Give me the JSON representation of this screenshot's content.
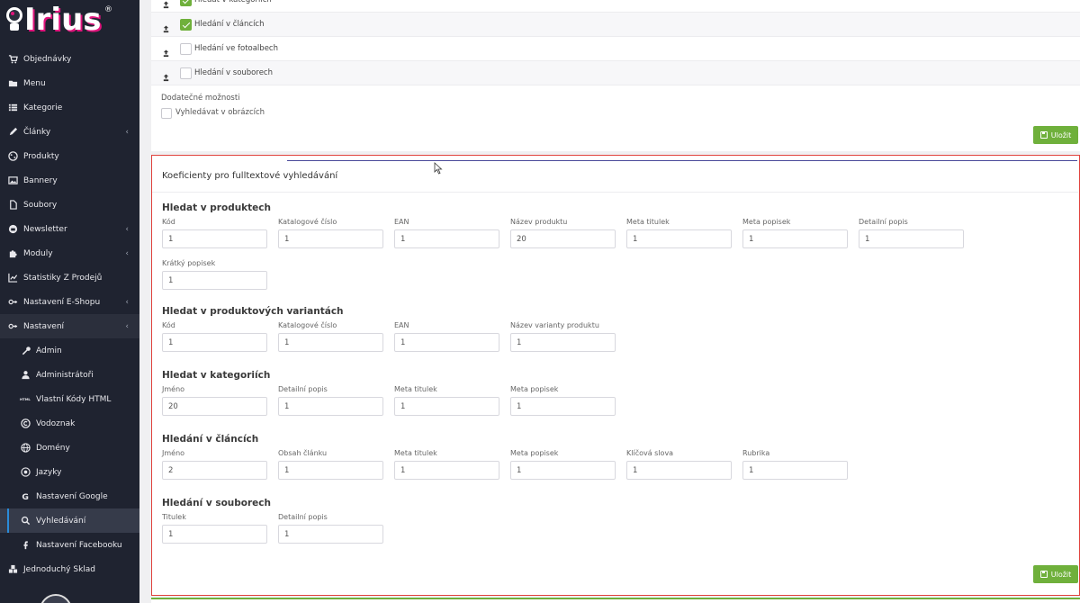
{
  "brand": {
    "logo_text": "Irius",
    "reg_mark": "®"
  },
  "sidebar": {
    "items": [
      {
        "label": "Objednávky",
        "icon": "cart-icon",
        "chevron": false
      },
      {
        "label": "Menu",
        "icon": "folder-icon",
        "chevron": false
      },
      {
        "label": "Kategorie",
        "icon": "list-icon",
        "chevron": false
      },
      {
        "label": "Články",
        "icon": "pen-icon",
        "chevron": true
      },
      {
        "label": "Produkty",
        "icon": "dice-icon",
        "chevron": false
      },
      {
        "label": "Bannery",
        "icon": "image-icon",
        "chevron": false
      },
      {
        "label": "Soubory",
        "icon": "file-icon",
        "chevron": false
      },
      {
        "label": "Newsletter",
        "icon": "envelope-icon",
        "chevron": true
      },
      {
        "label": "Moduly",
        "icon": "puzzle-icon",
        "chevron": true
      },
      {
        "label": "Statistiky Z Prodejů",
        "icon": "chart-icon",
        "chevron": false
      },
      {
        "label": "Nastavení E-Shopu",
        "icon": "toggle-icon",
        "chevron": true
      },
      {
        "label": "Nastavení",
        "icon": "toggle-icon",
        "chevron": true
      }
    ],
    "sub_items": [
      {
        "label": "Admin",
        "icon": "wrench-icon"
      },
      {
        "label": "Administrátoři",
        "icon": "user-icon"
      },
      {
        "label": "Vlastní Kódy HTML",
        "icon": "html-icon"
      },
      {
        "label": "Vodoznak",
        "icon": "copyright-icon"
      },
      {
        "label": "Domény",
        "icon": "globe-icon"
      },
      {
        "label": "Jazyky",
        "icon": "language-icon"
      },
      {
        "label": "Nastavení Google",
        "icon": "google-icon"
      },
      {
        "label": "Vyhledávání",
        "icon": "search-icon",
        "active": true
      },
      {
        "label": "Nastavení Facebooku",
        "icon": "facebook-icon"
      }
    ],
    "bottom_item": {
      "label": "Jednoduchý Sklad",
      "icon": "boxes-icon"
    }
  },
  "top_card": {
    "rows": [
      {
        "label": "Hledat v kategoriích",
        "checked": true
      },
      {
        "label": "Hledání v článcích",
        "checked": true
      },
      {
        "label": "Hledání ve fotoalbech",
        "checked": false
      },
      {
        "label": "Hledání v souborech",
        "checked": false
      }
    ],
    "extra_title": "Dodatečné možnosti",
    "extra_option": {
      "label": "Vyhledávat v obrázcích",
      "checked": false
    },
    "save_label": "Uložit"
  },
  "coef_card": {
    "title": "Koeficienty pro fulltextové vyhledávání",
    "save_label": "Uložit",
    "groups": [
      {
        "title": "Hledat v produktech",
        "fields": [
          {
            "label": "Kód",
            "value": "1"
          },
          {
            "label": "Katalogové číslo",
            "value": "1"
          },
          {
            "label": "EAN",
            "value": "1"
          },
          {
            "label": "Název produktu",
            "value": "20"
          },
          {
            "label": "Meta titulek",
            "value": "1"
          },
          {
            "label": "Meta popisek",
            "value": "1"
          },
          {
            "label": "Detailní popis",
            "value": "1"
          },
          {
            "label": "Krátký popisek",
            "value": "1"
          }
        ]
      },
      {
        "title": "Hledat v produktových variantách",
        "fields": [
          {
            "label": "Kód",
            "value": "1"
          },
          {
            "label": "Katalogové číslo",
            "value": "1"
          },
          {
            "label": "EAN",
            "value": "1"
          },
          {
            "label": "Název varianty produktu",
            "value": "1"
          }
        ]
      },
      {
        "title": "Hledat v kategoriích",
        "fields": [
          {
            "label": "Jméno",
            "value": "20"
          },
          {
            "label": "Detailní popis",
            "value": "1"
          },
          {
            "label": "Meta titulek",
            "value": "1"
          },
          {
            "label": "Meta popisek",
            "value": "1"
          }
        ]
      },
      {
        "title": "Hledání v článcích",
        "fields": [
          {
            "label": "Jméno",
            "value": "2"
          },
          {
            "label": "Obsah článku",
            "value": "1"
          },
          {
            "label": "Meta titulek",
            "value": "1"
          },
          {
            "label": "Meta popisek",
            "value": "1"
          },
          {
            "label": "Klíčová slova",
            "value": "1"
          },
          {
            "label": "Rubrika",
            "value": "1"
          }
        ]
      },
      {
        "title": "Hledání v souborech",
        "fields": [
          {
            "label": "Titulek",
            "value": "1"
          },
          {
            "label": "Detailní popis",
            "value": "1"
          }
        ]
      }
    ]
  },
  "colors": {
    "sidebar_bg": "#1f2330",
    "accent_green": "#6fb03b",
    "highlight_red": "#e0413c",
    "active_blue": "#2a8bd8"
  }
}
